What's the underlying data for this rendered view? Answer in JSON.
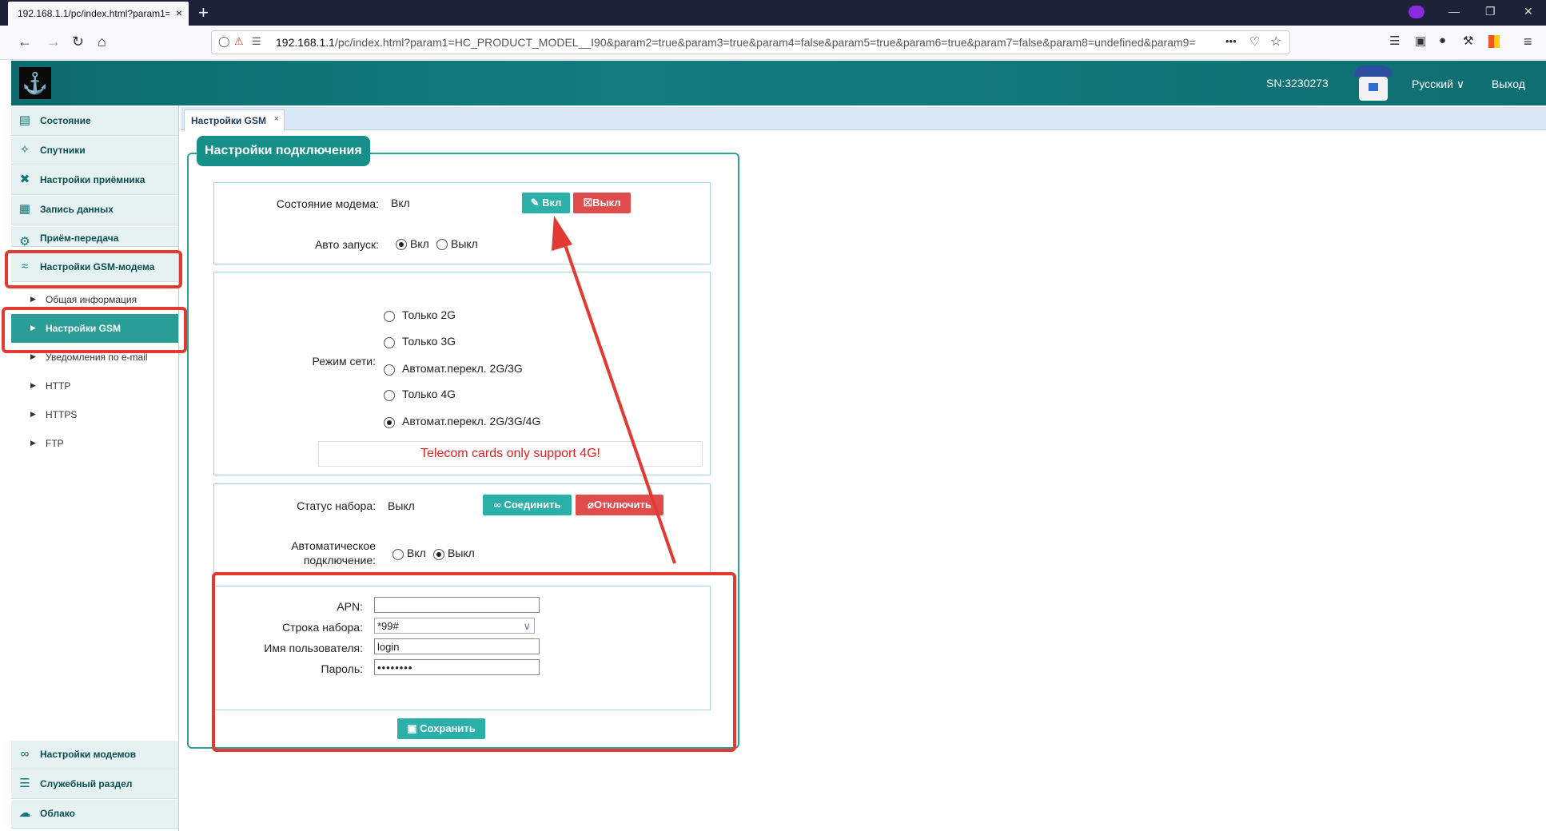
{
  "browser": {
    "tab_title": "192.168.1.1/pc/index.html?param1=",
    "tab_close": "×",
    "new_tab": "+",
    "url_host": "192.168.1.1",
    "url_path": "/pc/index.html?param1=HC_PRODUCT_MODEL__I90&param2=true&param3=true&param4=false&param5=true&param6=true&param7=false&param8=undefined&param9=",
    "url_more": "•••"
  },
  "header": {
    "serial": "SN:3230273",
    "language": "Русский",
    "logout": "Выход"
  },
  "sidebar": {
    "items": [
      {
        "label": "Состояние",
        "icon": "status-icon"
      },
      {
        "label": "Спутники",
        "icon": "satellite-icon"
      },
      {
        "label": "Настройки приёмника",
        "icon": "tools-icon"
      },
      {
        "label": "Запись данных",
        "icon": "record-icon"
      },
      {
        "label": "Приём-передача поправок",
        "icon": "gear-icon"
      },
      {
        "label": "Настройки GSM-модема",
        "icon": "wifi-icon"
      }
    ],
    "subitems": [
      {
        "label": "Общая информация"
      },
      {
        "label": "Настройки GSM"
      },
      {
        "label": "Уведомления по e-mail"
      },
      {
        "label": "HTTP"
      },
      {
        "label": "HTTPS"
      },
      {
        "label": "FTP"
      }
    ],
    "bottom_items": [
      {
        "label": "Настройки модемов",
        "icon": "modems-icon"
      },
      {
        "label": "Служебный раздел",
        "icon": "layers-icon"
      },
      {
        "label": "Облако",
        "icon": "cloud-icon"
      }
    ]
  },
  "content_tab": {
    "label": "Настройки GSM",
    "close": "×"
  },
  "panel": {
    "title": "Настройки подключения",
    "modem_state_label": "Состояние модема:",
    "modem_state_value": "Вкл",
    "on_button": "Вкл",
    "off_button": "Выкл",
    "autostart_label": "Авто запуск:",
    "autostart_on": "Вкл",
    "autostart_off": "Выкл",
    "autostart_selected": "Вкл",
    "network_mode_label": "Режим сети:",
    "network_modes": [
      "Только 2G",
      "Только 3G",
      "Автомат.перекл. 2G/3G",
      "Только 4G",
      "Автомат.перекл. 2G/3G/4G"
    ],
    "network_mode_selected": "Автомат.перекл. 2G/3G/4G",
    "notice": "Telecom cards only support 4G!",
    "dial_status_label": "Статус набора:",
    "dial_status_value": "Выкл",
    "connect_button": "Соединить",
    "disconnect_button": "Отключить",
    "auto_connect_label_1": "Автоматическое",
    "auto_connect_label_2": "подключение:",
    "auto_connect_on": "Вкл",
    "auto_connect_off": "Выкл",
    "auto_connect_selected": "Выкл",
    "apn_label": "APN:",
    "apn_value": "",
    "dial_string_label": "Строка набора:",
    "dial_string_value": "*99#",
    "username_label": "Имя пользователя:",
    "username_value": "login",
    "password_label": "Пароль:",
    "password_value": "••••••••",
    "save_button": "Сохранить"
  },
  "colors": {
    "accent": "#168f89",
    "annotation": "#e03a33",
    "danger": "#e04b4b"
  }
}
